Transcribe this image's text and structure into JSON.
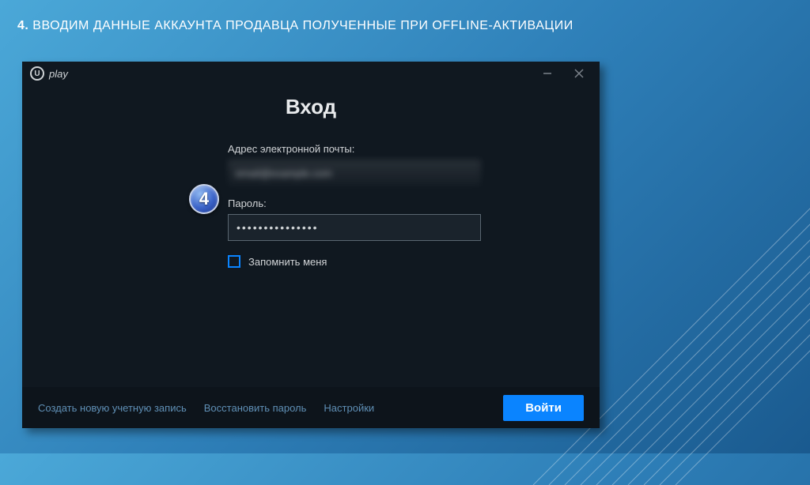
{
  "step": {
    "number": "4.",
    "heading": "ВВОДИМ ДАННЫЕ АККАУНТА ПРОДАВЦА ПОЛУЧЕННЫЕ ПРИ OFFLINE-АКТИВАЦИИ",
    "badge": "4"
  },
  "app": {
    "logo_glyph": "U",
    "logo_text": "play"
  },
  "login": {
    "title": "Вход",
    "email_label": "Адрес электронной почты:",
    "email_value": "email@example.com",
    "password_label": "Пароль:",
    "password_value": "•••••••••••••••",
    "remember_label": "Запомнить меня"
  },
  "footer": {
    "create_account": "Создать новую учетную запись",
    "recover_password": "Восстановить пароль",
    "settings": "Настройки",
    "login_button": "Войти"
  }
}
